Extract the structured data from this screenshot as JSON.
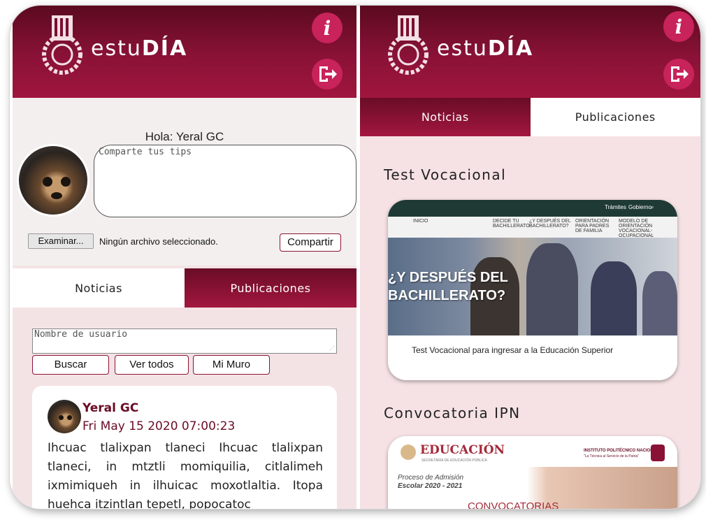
{
  "app": {
    "brand_prefix": "estu",
    "brand_suffix": "DÍA"
  },
  "left_screen": {
    "greeting": "Hola: Yeral GC",
    "tips_placeholder": "Comparte tus tips",
    "file_button": "Examinar...",
    "file_status": "Ningún archivo seleccionado.",
    "share_button": "Compartir",
    "tabs": [
      {
        "label": "Noticias",
        "active": false
      },
      {
        "label": "Publicaciones",
        "active": true
      }
    ],
    "username_placeholder": "Nombre de usuario",
    "buttons": {
      "search": "Buscar",
      "view_all": "Ver todos",
      "my_wall": "Mi Muro"
    },
    "post": {
      "author": "Yeral GC",
      "date": "Fri May 15 2020 07:00:23",
      "text": "Ihcuac tlalixpan tlaneci Ihcuac tlalixpan tlaneci, in mtztli momiquilia, citlalimeh ixmimiqueh in ilhuicac moxotlaltia. Itopa huehca itzintlan tepetl, popocatoc"
    }
  },
  "right_screen": {
    "tabs": [
      {
        "label": "Noticias",
        "active": true
      },
      {
        "label": "Publicaciones",
        "active": false
      }
    ],
    "sections": [
      {
        "title": "Test Vocacional",
        "card": {
          "top_bar": [
            "Trámites",
            "Gobierno"
          ],
          "nav_home": "INICIO",
          "nav_items": [
            "DECIDE TU BACHILLERATO",
            "¿Y DESPUÉS DEL BACHILLERATO?",
            "ORIENTACIÓN PARA PADRES DE FAMILIA",
            "MODELO DE ORIENTACIÓN VOCACIONAL-OCUPACIONAL"
          ],
          "hero_line1": "¿Y DESPUÉS DEL",
          "hero_line2": "BACHILLERATO?",
          "caption": "Test Vocacional para ingresar a la Educación Superior"
        }
      },
      {
        "title": "Convocatoria IPN",
        "card": {
          "header_text": "EDUCACIÓN",
          "header_sub": "SECRETARÍA DE EDUCACIÓN PÚBLICA",
          "institute": "INSTITUTO POLITÉCNICO NACIONAL",
          "institute_tagline": "\"La Técnica al Servicio de la Patria\"",
          "process_line1": "Proceso de Admisión",
          "process_line2": "Escolar 2020 - 2021",
          "banner": "CONVOCATORIAS"
        }
      }
    ]
  },
  "colors": {
    "primary": "#8a1236",
    "primary_dark": "#5b0a20",
    "accent": "#c8235a",
    "body_bg": "#f4e3e5"
  },
  "icons": [
    "info-icon",
    "logout-icon",
    "ipn-logo"
  ]
}
